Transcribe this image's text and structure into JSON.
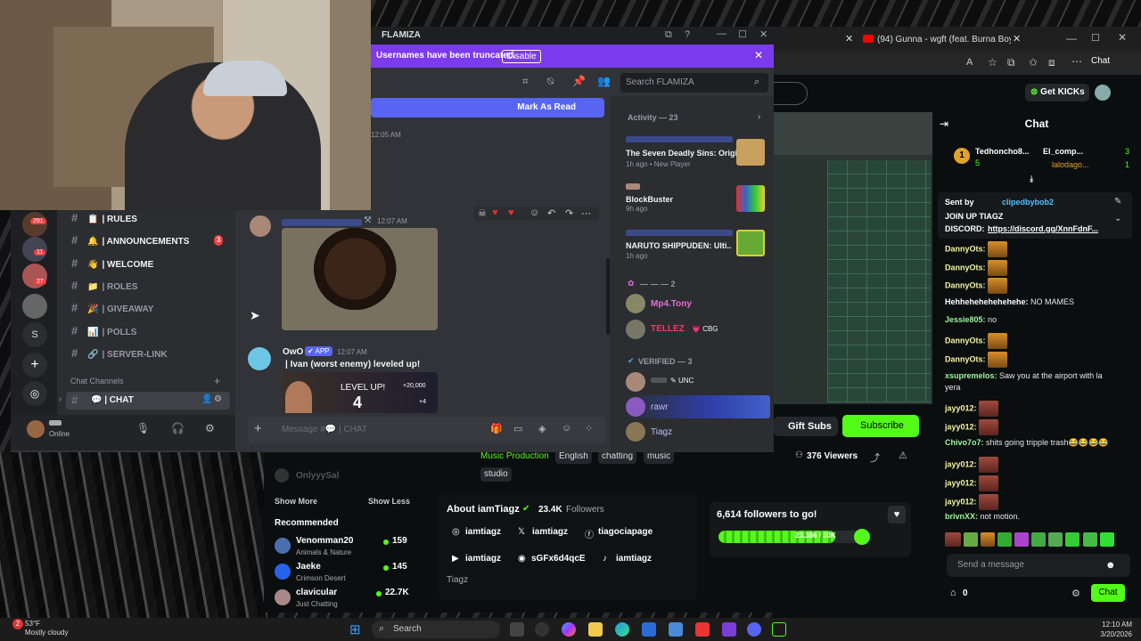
{
  "browser": {
    "tab_label": "(94) Gunna - wgft (feat. Burna Boy",
    "chat_label": "Chat"
  },
  "kick": {
    "get_kicks": "Get KICKs",
    "chat_title": "Chat",
    "top_gifters": [
      {
        "name": "Tedhoncho8...",
        "count": "5"
      },
      {
        "name": "El_comp...",
        "count": "3"
      },
      {
        "name": "lalodago...",
        "count": "1"
      }
    ],
    "pinned": {
      "sent_by_prefix": "Sent by",
      "sent_by_user": "clipedbybob2",
      "line1": "JOIN UP TIAGZ",
      "line2_label": "DISCORD:",
      "line2_link": "https://discord.gg/XnnFdnF..."
    },
    "messages": [
      {
        "user": "DannyOts:",
        "text": "",
        "emote": true
      },
      {
        "user": "DannyOts:",
        "text": "",
        "emote": true
      },
      {
        "user": "DannyOts:",
        "text": "",
        "emote": true
      },
      {
        "user": "Hehhehehehehehehe:",
        "text": "NO MAMES",
        "emote": false
      },
      {
        "user": "Jessie805:",
        "text": "no",
        "emote": false
      },
      {
        "user": "DannyOts:",
        "text": "",
        "emote": true
      },
      {
        "user": "DannyOts:",
        "text": "",
        "emote": true
      },
      {
        "user": "xsupremelos:",
        "text": "Saw you at the airport with la",
        "emote": false
      },
      {
        "user": "",
        "text": "yera",
        "emote": false
      },
      {
        "user": "jayy012:",
        "text": "",
        "emote": true
      },
      {
        "user": "jayy012:",
        "text": "",
        "emote": true
      },
      {
        "user": "Chivo7o7:",
        "text": "shits going tripple trash😂😂😂😂",
        "emote": false
      },
      {
        "user": "jayy012:",
        "text": "",
        "emote": true
      },
      {
        "user": "jayy012:",
        "text": "",
        "emote": true
      },
      {
        "user": "jayy012:",
        "text": "",
        "emote": true
      },
      {
        "user": "brivnXX:",
        "text": "not motion.",
        "emote": false
      }
    ],
    "send_placeholder": "Send a message",
    "kick_count": "0",
    "chat_button": "Chat",
    "gift_subs": "Gift Subs",
    "subscribe": "Subscribe",
    "viewers": "376 Viewers",
    "tags": [
      "Music Production",
      "English",
      "chatting",
      "music",
      "studio"
    ],
    "about_title": "About iamTiagz",
    "followers": "23.4K",
    "followers_label": "Followers",
    "socials": [
      {
        "icon": "instagram-icon",
        "label": "iamtiagz"
      },
      {
        "icon": "x-icon",
        "label": "iamtiagz"
      },
      {
        "icon": "facebook-icon",
        "label": "tiagociapage"
      },
      {
        "icon": "youtube-icon",
        "label": "iamtiagz"
      },
      {
        "icon": "discord-icon",
        "label": "sGFx6d4qcE"
      },
      {
        "icon": "tiktok-icon",
        "label": "iamtiagz"
      }
    ],
    "about_name": "Tiagz",
    "goal_text": "6,614 followers to go!",
    "goal_progress": "23,386 / 30K",
    "goal_fraction": 0.78,
    "side": {
      "only_user": "OnlyyySal",
      "show_more": "Show More",
      "show_less": "Show Less",
      "recommended": "Recommended",
      "items": [
        {
          "name": "Venomman20",
          "category": "Animals & Nature",
          "viewers": "159"
        },
        {
          "name": "Jaeke",
          "category": "Crimson Desert",
          "viewers": "145"
        },
        {
          "name": "clavicular",
          "category": "Just Chatting",
          "viewers": "22.7K"
        }
      ]
    }
  },
  "discord": {
    "window_title": "FLAMIZA",
    "banner": "Usernames have been truncated.",
    "disable": "Disable",
    "search_placeholder": "Search FLAMIZA",
    "mark_as_read": "Mark As Read",
    "time1": "12:05 AM",
    "time2": "12:07 AM",
    "owo_user": "OwO",
    "app_badge": "APP",
    "time3": "12:07 AM",
    "levelup_text": "| Ivan (worst enemy) leveled up!",
    "level_label": "LEVEL UP!",
    "level_num": "4",
    "level_xp": "+20,000",
    "level_plus": "+4",
    "message_placeholder": "Message #💬 | CHAT",
    "channels": [
      {
        "label": "| RULES",
        "icon": "📋",
        "bright": true
      },
      {
        "label": "| ANNOUNCEMENTS",
        "icon": "🔔",
        "bright": true,
        "badge": "3"
      },
      {
        "label": "| WELCOME",
        "icon": "👋",
        "bright": true
      },
      {
        "label": "| ROLES",
        "icon": "📁",
        "bright": false
      },
      {
        "label": "| GIVEAWAY",
        "icon": "🎉",
        "bright": false
      },
      {
        "label": "| POLLS",
        "icon": "📊",
        "bright": false
      },
      {
        "label": "| SERVER-LINK",
        "icon": "🔗",
        "bright": false
      }
    ],
    "chat_category": "Chat Channels",
    "chat_channel": "| CHAT",
    "server_badges": [
      "291",
      "11",
      "27"
    ],
    "server_letter": "S",
    "user_status": "Online",
    "activity_header": "Activity — 23",
    "activities": [
      {
        "title": "The Seven Deadly Sins: Origin",
        "sub": "1h ago  •  New Player"
      },
      {
        "title": "BlockBuster",
        "sub": "9h ago"
      },
      {
        "title": "NARUTO SHIPPUDEN: Ulti...",
        "sub": "1h ago"
      }
    ],
    "group1_header": "— — — 2",
    "group1": [
      "Mp4.Tony",
      "TELLEZ"
    ],
    "cbg": "CBG",
    "verified_header": "VERIFIED — 3",
    "unc": "UNC",
    "verified": [
      "rawr",
      "Tiagz"
    ]
  },
  "taskbar": {
    "search": "Search",
    "temp": "53°F",
    "weather": "Mostly cloudy",
    "time": "12:10 AM",
    "date": "3/20/2026",
    "weather_badge": "2"
  }
}
